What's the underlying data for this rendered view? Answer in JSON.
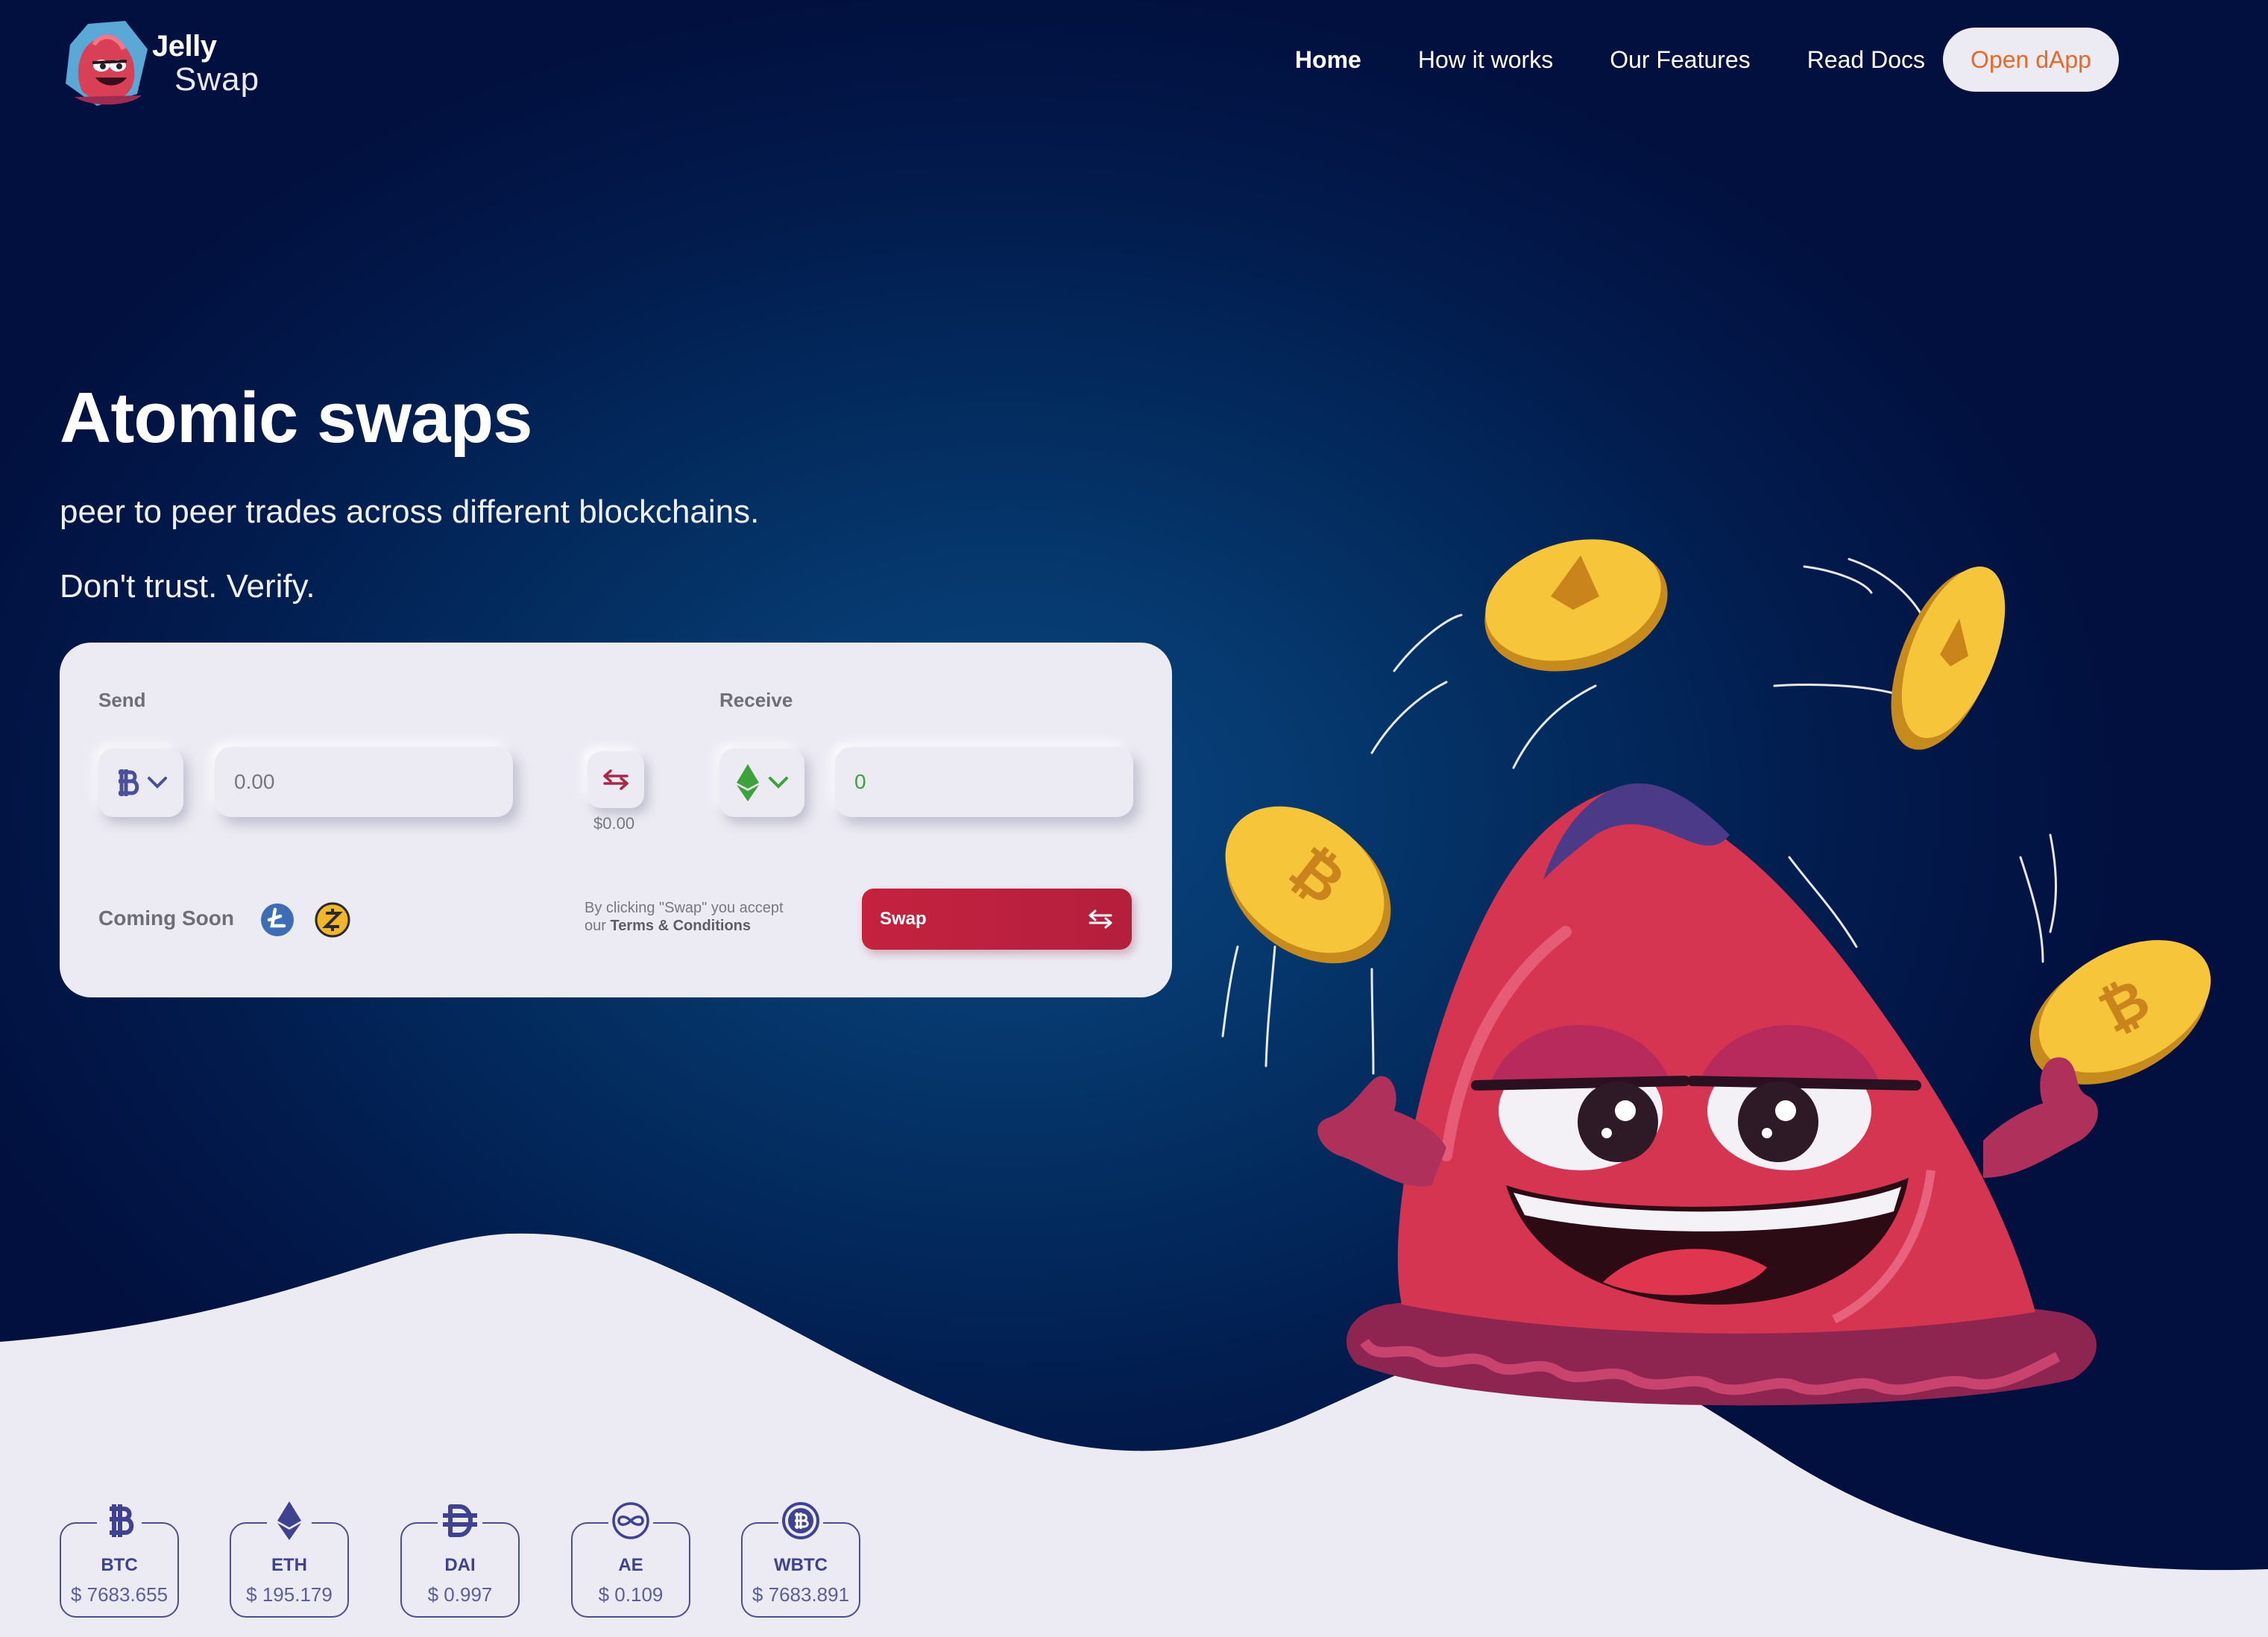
{
  "brand": {
    "name_line1": "Jelly",
    "name_line2": "Swap"
  },
  "nav": {
    "links": [
      "Home",
      "How it works",
      "Our Features",
      "Read Docs"
    ],
    "active": "Home",
    "cta": "Open dApp"
  },
  "hero": {
    "title": "Atomic swaps",
    "subtitle": "peer to peer trades across different blockchains.",
    "tagline": "Don't trust. Verify."
  },
  "swap_card": {
    "send_label": "Send",
    "receive_label": "Receive",
    "send_coin_icon": "bitcoin-icon",
    "receive_coin_icon": "ethereum-icon",
    "send_value": "0.00",
    "receive_value": "0",
    "usd_value": "$0.00",
    "coming_soon_label": "Coming Soon",
    "coming_soon_icons": [
      "litecoin-icon",
      "zcash-icon"
    ],
    "terms_line1": "By clicking \"Swap\" you accept",
    "terms_line2_prefix": "our ",
    "terms_link": "Terms & Conditions",
    "swap_button": "Swap"
  },
  "tickers": [
    {
      "symbol": "BTC",
      "price": "$ 7683.655",
      "icon": "bitcoin-icon"
    },
    {
      "symbol": "ETH",
      "price": "$ 195.179",
      "icon": "ethereum-icon"
    },
    {
      "symbol": "DAI",
      "price": "$ 0.997",
      "icon": "dai-icon"
    },
    {
      "symbol": "AE",
      "price": "$ 0.109",
      "icon": "aeternity-icon"
    },
    {
      "symbol": "WBTC",
      "price": "$ 7683.891",
      "icon": "wbtc-icon"
    }
  ],
  "colors": {
    "navy_dark": "#01103f",
    "navy_mid": "#05467f",
    "background_light": "#ecebf3",
    "accent_orange": "#e56a27",
    "swap_red": "#c4223f",
    "ticker_blue": "#3e4291",
    "btc_purple": "#4b4f9a",
    "eth_green": "#3ca33c"
  }
}
